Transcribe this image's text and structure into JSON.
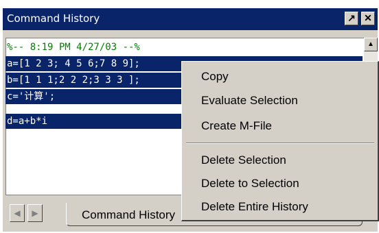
{
  "window": {
    "title": "Command History",
    "pin_glyph": "↗",
    "close_glyph": "✕"
  },
  "history": {
    "lines": [
      "%-- 8:19 PM 4/27/03 --%",
      "a=[1 2 3; 4 5 6;7 8 9];",
      "b=[1 1 1;2 2 2;3 3 3 ];",
      "c='计算';",
      "d=a+b*i"
    ],
    "session_color": "#008000",
    "selection_color": "#0a246a"
  },
  "scrollbar": {
    "up_glyph": "▲"
  },
  "context_menu": {
    "items": [
      "Copy",
      "Evaluate Selection",
      "Create M-File",
      "Delete Selection",
      "Delete to Selection",
      "Delete Entire History"
    ]
  },
  "tabs": {
    "left_glyph": "◀",
    "right_glyph": "▶",
    "active_label": "Command History"
  }
}
